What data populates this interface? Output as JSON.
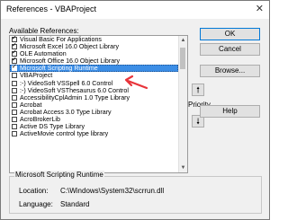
{
  "window": {
    "title": "References - VBAProject",
    "close_glyph": "✕"
  },
  "available_label": "Available References:",
  "references": [
    {
      "label": "Visual Basic For Applications",
      "checked": true,
      "selected": false
    },
    {
      "label": "Microsoft Excel 16.0 Object Library",
      "checked": true,
      "selected": false
    },
    {
      "label": "OLE Automation",
      "checked": true,
      "selected": false
    },
    {
      "label": "Microsoft Office 16.0 Object Library",
      "checked": true,
      "selected": false
    },
    {
      "label": "Microsoft Scripting Runtime",
      "checked": true,
      "selected": true
    },
    {
      "label": "VBAProject",
      "checked": false,
      "selected": false
    },
    {
      "label": ":-) VideoSoft VSSpell 6.0 Control",
      "checked": false,
      "selected": false
    },
    {
      "label": ":-) VideoSoft VSThesaurus 6.0 Control",
      "checked": false,
      "selected": false
    },
    {
      "label": "AccessibilityCplAdmin 1.0 Type Library",
      "checked": false,
      "selected": false
    },
    {
      "label": "Acrobat",
      "checked": false,
      "selected": false
    },
    {
      "label": "Acrobat Access 3.0 Type Library",
      "checked": false,
      "selected": false
    },
    {
      "label": "AcroBrokerLib",
      "checked": false,
      "selected": false
    },
    {
      "label": "Active DS Type Library",
      "checked": false,
      "selected": false
    },
    {
      "label": "ActiveMovie control type library",
      "checked": false,
      "selected": false
    }
  ],
  "buttons": {
    "ok": "OK",
    "cancel": "Cancel",
    "browse": "Browse...",
    "help": "Help"
  },
  "priority": {
    "label": "Priority",
    "up_glyph": "🠕",
    "down_glyph": "🠗"
  },
  "details": {
    "title": "Microsoft Scripting Runtime",
    "location_label": "Location:",
    "location_value": "C:\\Windows\\System32\\scrrun.dll",
    "language_label": "Language:",
    "language_value": "Standard"
  },
  "colors": {
    "selection": "#3c8ee6",
    "annotation_arrow": "#e8343a",
    "default_button_border": "#0078d7"
  }
}
